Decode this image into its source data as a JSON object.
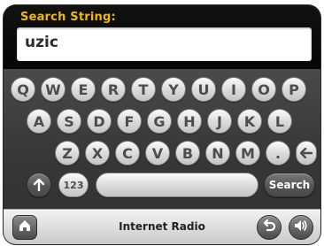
{
  "search": {
    "label": "Search String:",
    "value": "uzic"
  },
  "keyboard": {
    "row1": [
      "Q",
      "W",
      "E",
      "R",
      "T",
      "Y",
      "U",
      "I",
      "O",
      "P"
    ],
    "row2": [
      "A",
      "S",
      "D",
      "F",
      "G",
      "H",
      "J",
      "K",
      "L"
    ],
    "row3": [
      "Z",
      "X",
      "C",
      "V",
      "B",
      "N",
      "M",
      "."
    ],
    "numbers_label": "123",
    "search_label": "Search",
    "icons": {
      "backspace": "left-arrow-icon",
      "shift": "up-arrow-icon"
    }
  },
  "bottom_bar": {
    "title": "Internet Radio",
    "icons": {
      "home": "home-icon",
      "back": "back-icon",
      "volume": "volume-icon"
    }
  },
  "colors": {
    "accent": "#f2b705",
    "panel": "#0b0b0b",
    "keyboard_bg": "#3f3f3f",
    "key_light": "#e2e2e2",
    "key_dark": "#555555"
  }
}
